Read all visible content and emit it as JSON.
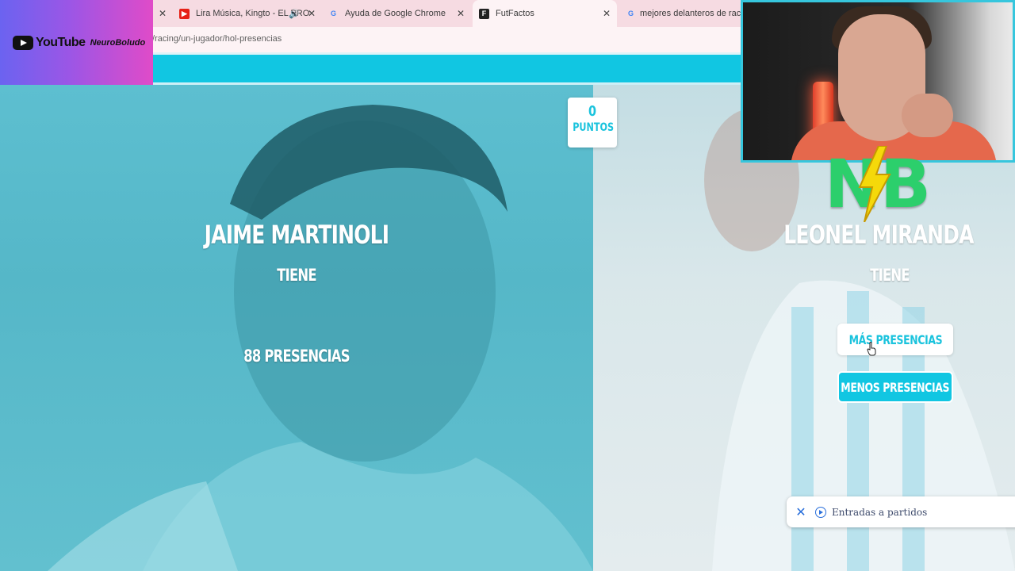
{
  "browser": {
    "tabs": [
      {
        "label": "Lira Música, Kingto - EL PRO",
        "icon": "youtube-icon",
        "muted_icon": "speaker-icon"
      },
      {
        "label": "Ayuda de Google Chrome",
        "icon": "google-icon"
      },
      {
        "label": "FutFactos",
        "icon": "futfactos-icon",
        "active": true
      },
      {
        "label": "mejores delanteros de racing",
        "icon": "google-icon"
      }
    ],
    "url": "/racing/un-jugador/hol-presencias"
  },
  "overlay": {
    "youtube_word": "YouTube",
    "channel": "NeuroBoludo",
    "logo_letters": [
      "N",
      "B"
    ]
  },
  "game": {
    "score": {
      "value": "0",
      "label": "PUNTOS"
    },
    "left": {
      "name": "JAIME MARTINOLI",
      "tiene": "TIENE",
      "count": "88 PRESENCIAS"
    },
    "right": {
      "name": "LEONEL MIRANDA",
      "tiene": "TIENE"
    },
    "buttons": {
      "more": "MÁS PRESENCIAS",
      "less": "MENOS PRESENCIAS"
    }
  },
  "notification": {
    "text": "Entradas a partidos"
  },
  "colors": {
    "accent": "#11c6e2",
    "left_panel": "#5dbfd0",
    "right_panel": "#d9e7ea",
    "logo_green": "#2ccf6c",
    "bolt": "#f5d90a"
  }
}
